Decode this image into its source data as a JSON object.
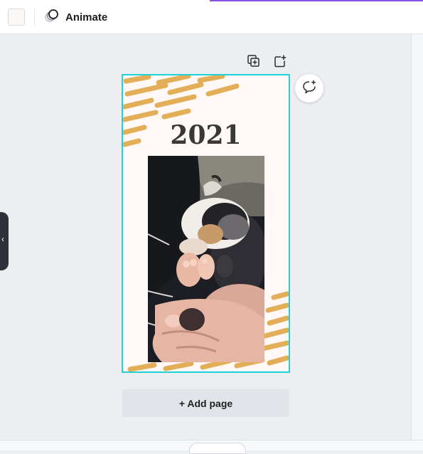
{
  "toolbar": {
    "animate_label": "Animate",
    "color_swatch": "#fbf8f6"
  },
  "page_actions": {
    "duplicate_icon": "duplicate-page-icon",
    "add_icon": "add-page-icon"
  },
  "canvas": {
    "year_text": "2021",
    "border_color": "#1fd2d8",
    "background_color": "#fff8f6",
    "decoration_color": "#e0a84a",
    "photo": "puppy-photo"
  },
  "comment": {
    "icon": "add-comment-icon"
  },
  "side_panel": {
    "toggle_label": "‹"
  },
  "footer": {
    "add_page_label": "+ Add page"
  }
}
